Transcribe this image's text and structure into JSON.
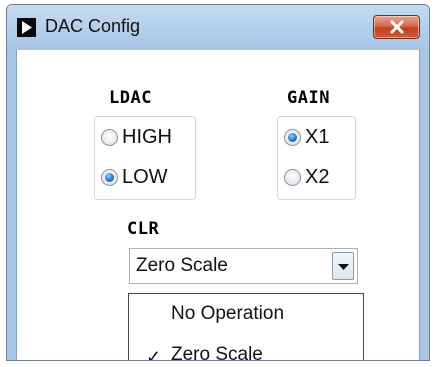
{
  "window": {
    "title": "DAC Config",
    "close_icon": "close-icon",
    "app_icon": "play-triangle-icon"
  },
  "ldac": {
    "label": "LDAC",
    "options": [
      {
        "label": "HIGH",
        "checked": false
      },
      {
        "label": "LOW",
        "checked": true
      }
    ]
  },
  "gain": {
    "label": "GAIN",
    "options": [
      {
        "label": "X1",
        "checked": true
      },
      {
        "label": "X2",
        "checked": false
      }
    ]
  },
  "clr": {
    "label": "CLR",
    "selected": "Zero Scale",
    "arrow_icon": "chevron-down-icon",
    "options": [
      {
        "label": "No Operation",
        "checked": false
      },
      {
        "label": "Zero Scale",
        "checked": true
      }
    ],
    "check_mark": "✓"
  },
  "colors": {
    "titlebar": "#b2cde9",
    "close_button": "#c1401f",
    "radio_selected": "#1c6fc9"
  }
}
